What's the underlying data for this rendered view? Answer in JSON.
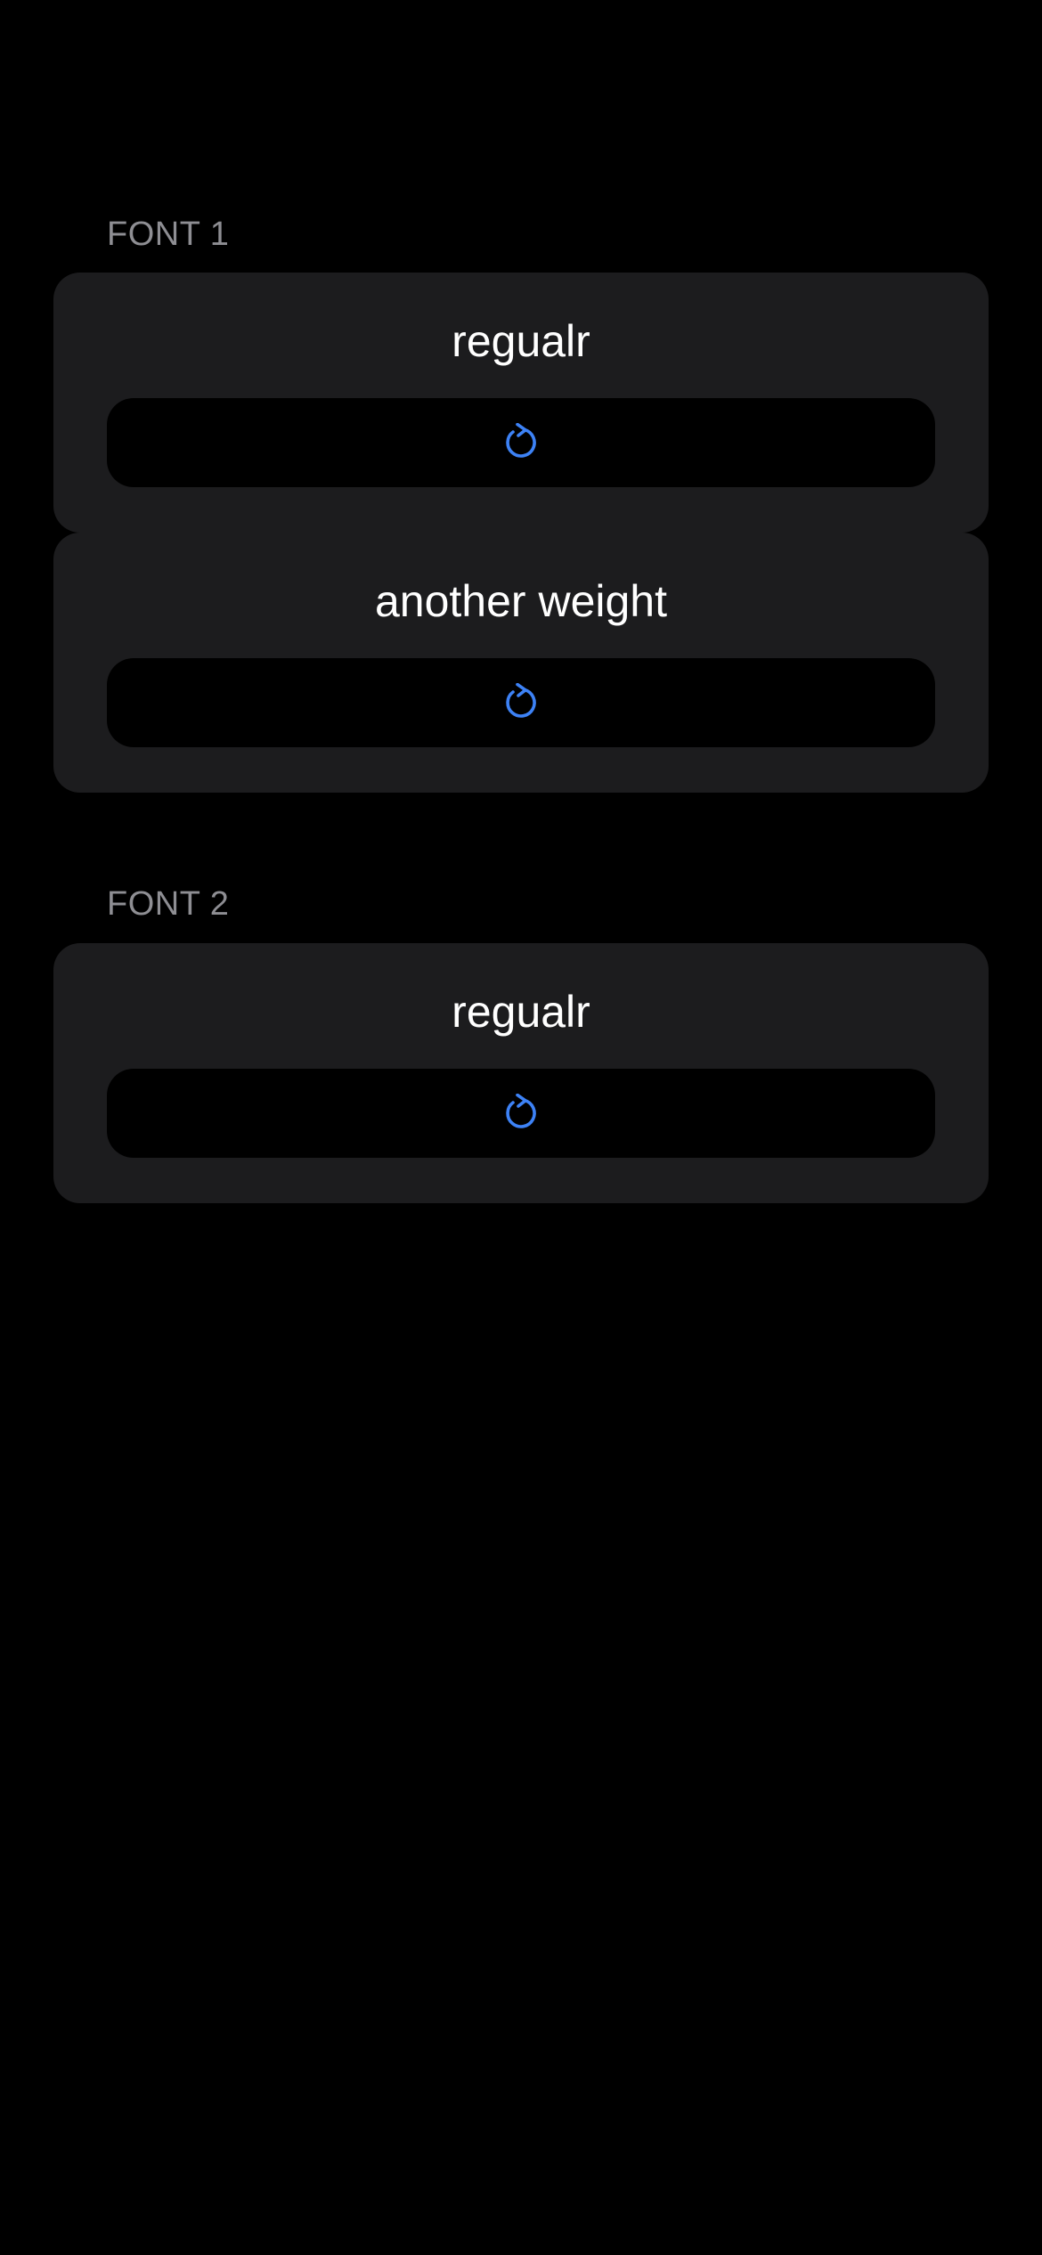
{
  "colors": {
    "background": "#000000",
    "card": "#1c1c1e",
    "button": "#000000",
    "header_text": "#8e8e93",
    "title_text": "#ffffff",
    "accent": "#3d82f6"
  },
  "sections": [
    {
      "header": "FONT 1",
      "cards": [
        {
          "title": "regualr",
          "button_icon": "refresh-icon"
        },
        {
          "title": "another weight",
          "button_icon": "refresh-icon"
        }
      ]
    },
    {
      "header": "FONT 2",
      "cards": [
        {
          "title": "regualr",
          "button_icon": "refresh-icon"
        }
      ]
    }
  ]
}
